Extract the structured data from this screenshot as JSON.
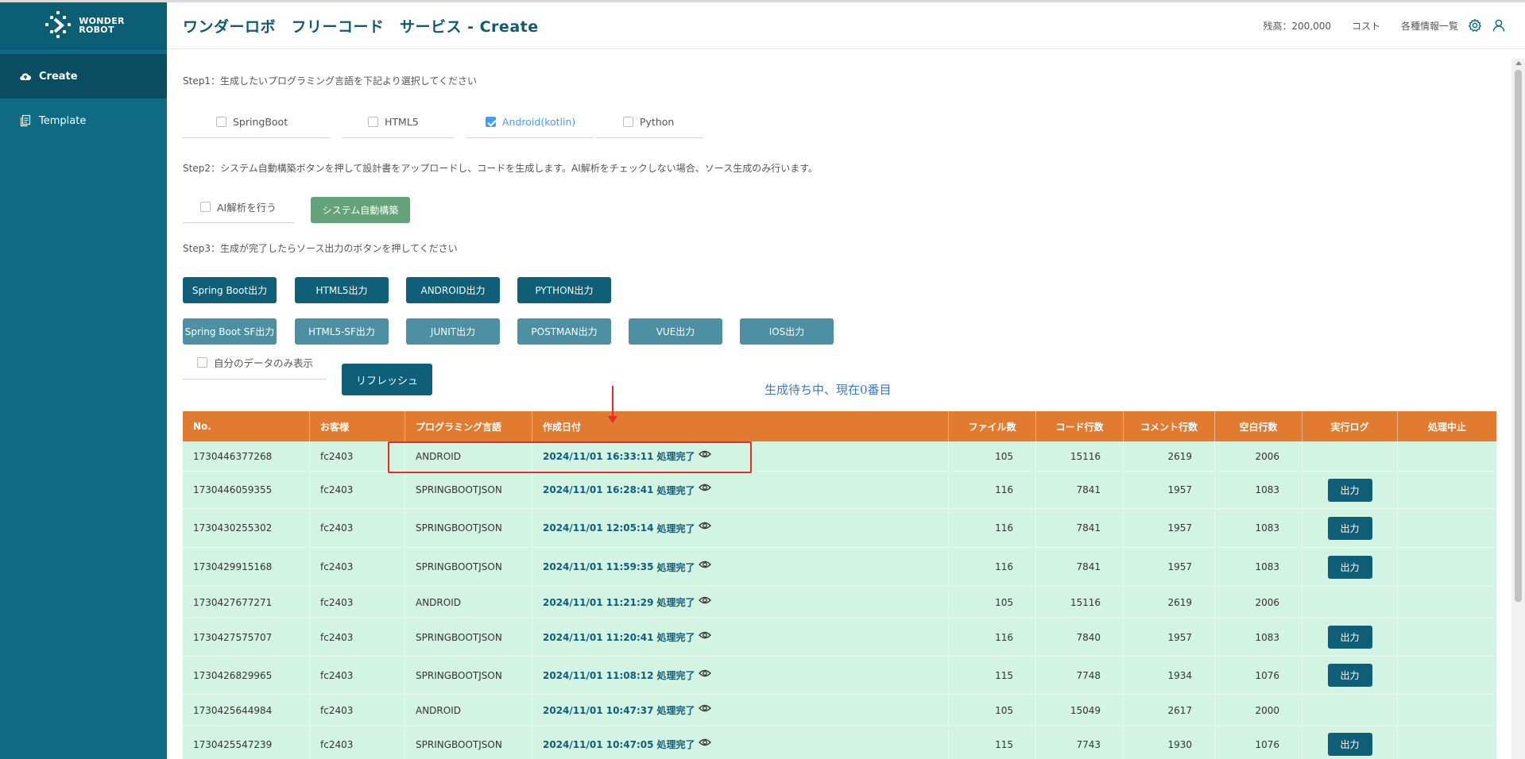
{
  "app": {
    "logo_line1": "WONDER",
    "logo_line2": "ROBOT",
    "title": "ワンダーロボ　フリーコード　サービス - Create"
  },
  "sidebar": {
    "items": [
      {
        "label": "Create",
        "icon": "cloud-upload-icon",
        "active": true
      },
      {
        "label": "Template",
        "icon": "copy-document-icon",
        "active": false
      }
    ]
  },
  "header": {
    "balance": "残高：200,000",
    "cost": "コスト",
    "info": "各種情報一覧"
  },
  "step1": {
    "text": "Step1：生成したいプログラミング言語を下記より選択してください",
    "options": [
      {
        "label": "SpringBoot",
        "checked": false
      },
      {
        "label": "HTML5",
        "checked": false
      },
      {
        "label": "Android(kotlin)",
        "checked": true
      },
      {
        "label": "Python",
        "checked": false
      }
    ]
  },
  "step2": {
    "text": "Step2：システム自動構築ボタンを押して設計書をアップロードし、コードを生成します。AI解析をチェックしない場合、ソース生成のみ行います。",
    "ai_label": "AI解析を行う",
    "build_button": "システム自動構築"
  },
  "step3": {
    "text": "Step3：生成が完了したらソース出力のボタンを押してください",
    "row1": [
      "Spring Boot出力",
      "HTML5出力",
      "ANDROID出力",
      "PYTHON出力"
    ],
    "row2": [
      "Spring Boot SF出力",
      "HTML5-SF出力",
      "JUNIT出力",
      "POSTMAN出力",
      "VUE出力",
      "IOS出力"
    ]
  },
  "filter": {
    "mine_label": "自分のデータのみ表示",
    "refresh_button": "リフレッシュ"
  },
  "annotation": "生成待ち中、現在0番目",
  "table": {
    "headers": [
      "No.",
      "お客様",
      "プログラミング言語",
      "作成日付",
      "ファイル数",
      "コード行数",
      "コメント行数",
      "空白行数",
      "実行ログ",
      "処理中止"
    ],
    "rows": [
      {
        "no": "1730446377268",
        "customer": "fc2403",
        "lang": "ANDROID",
        "date": "2024/11/01 16:33:11",
        "status": "処理完了",
        "files": "105",
        "code": "15116",
        "comment": "2619",
        "blank": "2006",
        "log": ""
      },
      {
        "no": "1730446059355",
        "customer": "fc2403",
        "lang": "SPRINGBOOTJSON",
        "date": "2024/11/01 16:28:41",
        "status": "処理完了",
        "files": "116",
        "code": "7841",
        "comment": "1957",
        "blank": "1083",
        "log": "出力"
      },
      {
        "no": "1730430255302",
        "customer": "fc2403",
        "lang": "SPRINGBOOTJSON",
        "date": "2024/11/01 12:05:14",
        "status": "処理完了",
        "files": "116",
        "code": "7841",
        "comment": "1957",
        "blank": "1083",
        "log": "出力"
      },
      {
        "no": "1730429915168",
        "customer": "fc2403",
        "lang": "SPRINGBOOTJSON",
        "date": "2024/11/01 11:59:35",
        "status": "処理完了",
        "files": "116",
        "code": "7841",
        "comment": "1957",
        "blank": "1083",
        "log": "出力"
      },
      {
        "no": "1730427677271",
        "customer": "fc2403",
        "lang": "ANDROID",
        "date": "2024/11/01 11:21:29",
        "status": "処理完了",
        "files": "105",
        "code": "15116",
        "comment": "2619",
        "blank": "2006",
        "log": ""
      },
      {
        "no": "1730427575707",
        "customer": "fc2403",
        "lang": "SPRINGBOOTJSON",
        "date": "2024/11/01 11:20:41",
        "status": "処理完了",
        "files": "116",
        "code": "7840",
        "comment": "1957",
        "blank": "1083",
        "log": "出力"
      },
      {
        "no": "1730426829965",
        "customer": "fc2403",
        "lang": "SPRINGBOOTJSON",
        "date": "2024/11/01 11:08:12",
        "status": "処理完了",
        "files": "115",
        "code": "7748",
        "comment": "1934",
        "blank": "1076",
        "log": "出力"
      },
      {
        "no": "1730425644984",
        "customer": "fc2403",
        "lang": "ANDROID",
        "date": "2024/11/01 10:47:37",
        "status": "処理完了",
        "files": "105",
        "code": "15049",
        "comment": "2617",
        "blank": "2000",
        "log": ""
      },
      {
        "no": "1730425547239",
        "customer": "fc2403",
        "lang": "SPRINGBOOTJSON",
        "date": "2024/11/01 10:47:05",
        "status": "処理完了",
        "files": "115",
        "code": "7743",
        "comment": "1930",
        "blank": "1076",
        "log": "出力"
      }
    ]
  },
  "colors": {
    "sidebar": "#0f6b84",
    "table_header": "#e07b2f",
    "row_bg": "#d4f4e3",
    "primary_button": "#0f5f78",
    "highlight": "#e52a2a"
  }
}
